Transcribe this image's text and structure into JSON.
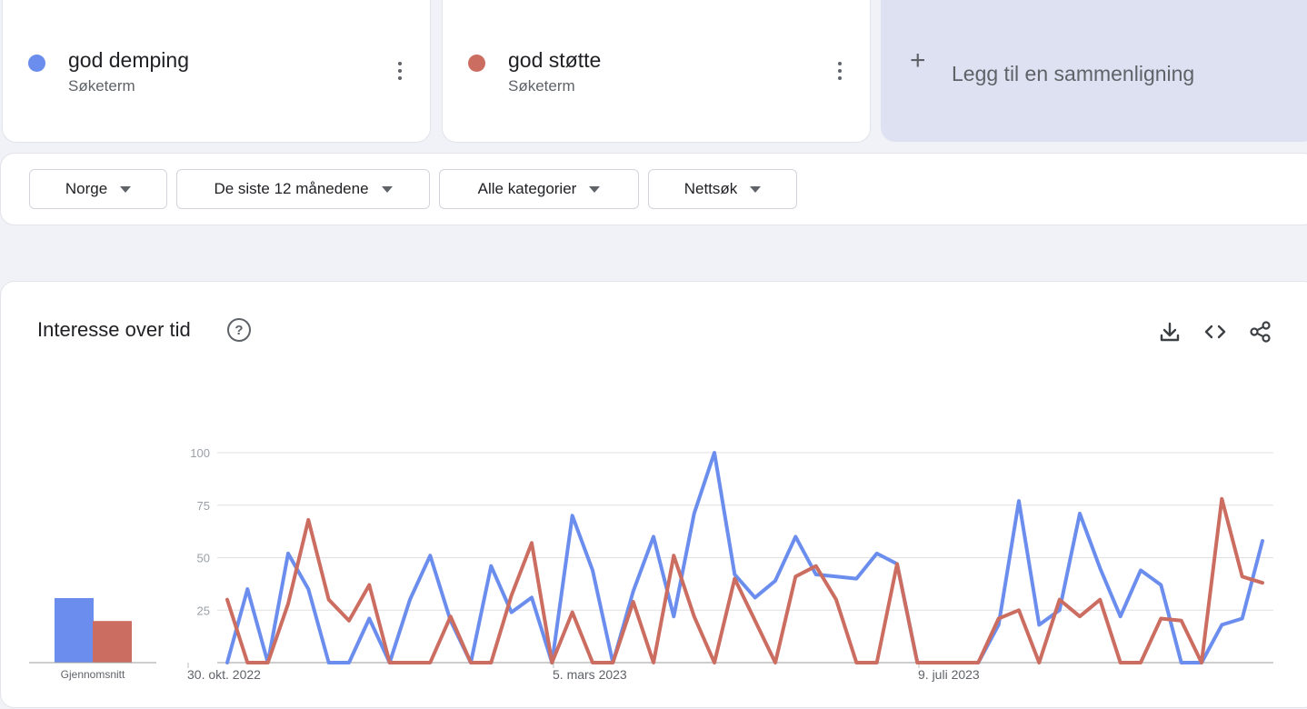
{
  "terms": [
    {
      "name": "god demping",
      "type": "Søketerm",
      "color": "#6b8ded"
    },
    {
      "name": "god støtte",
      "type": "Søketerm",
      "color": "#cc6d61"
    }
  ],
  "add_comparison": {
    "label": "Legg til en sammenligning"
  },
  "filters": {
    "region": "Norge",
    "period": "De siste 12 månedene",
    "category": "Alle kategorier",
    "search_type": "Nettsøk"
  },
  "chart_card": {
    "title": "Interesse over tid"
  },
  "icons": {
    "help": "help-circle-icon",
    "download": "download-icon",
    "embed": "code-icon",
    "share": "share-icon"
  },
  "chart_data": {
    "type": "line",
    "y_ticks": [
      25,
      50,
      75,
      100
    ],
    "y_tick_labels": [
      "25",
      "50",
      "75",
      "100"
    ],
    "ylim": [
      0,
      100
    ],
    "x_tick_labels": [
      "30. okt. 2022",
      "5. mars 2023",
      "9. juli 2023"
    ],
    "x_tick_indices": [
      0,
      18,
      36
    ],
    "grid": true,
    "series": [
      {
        "name": "god demping",
        "color": "#6b8ded",
        "values": [
          0,
          35,
          0,
          52,
          35,
          0,
          0,
          21,
          0,
          30,
          51,
          20,
          0,
          46,
          24,
          31,
          0,
          70,
          44,
          0,
          34,
          60,
          22,
          71,
          100,
          42,
          31,
          39,
          60,
          42,
          41,
          40,
          52,
          47,
          0,
          0,
          0,
          0,
          18,
          77,
          18,
          25,
          71,
          45,
          22,
          44,
          37,
          0,
          0,
          18,
          21,
          58
        ]
      },
      {
        "name": "god støtte",
        "color": "#cc6d61",
        "values": [
          30,
          0,
          0,
          28,
          68,
          30,
          20,
          37,
          0,
          0,
          0,
          22,
          0,
          0,
          32,
          57,
          0,
          24,
          0,
          0,
          29,
          0,
          51,
          22,
          0,
          40,
          20,
          0,
          41,
          46,
          30,
          0,
          0,
          47,
          0,
          0,
          0,
          0,
          21,
          25,
          0,
          30,
          22,
          30,
          0,
          0,
          21,
          20,
          0,
          78,
          41,
          38
        ]
      }
    ],
    "averages": {
      "label": "Gjennomsnitt",
      "values": [
        31,
        20
      ]
    }
  }
}
